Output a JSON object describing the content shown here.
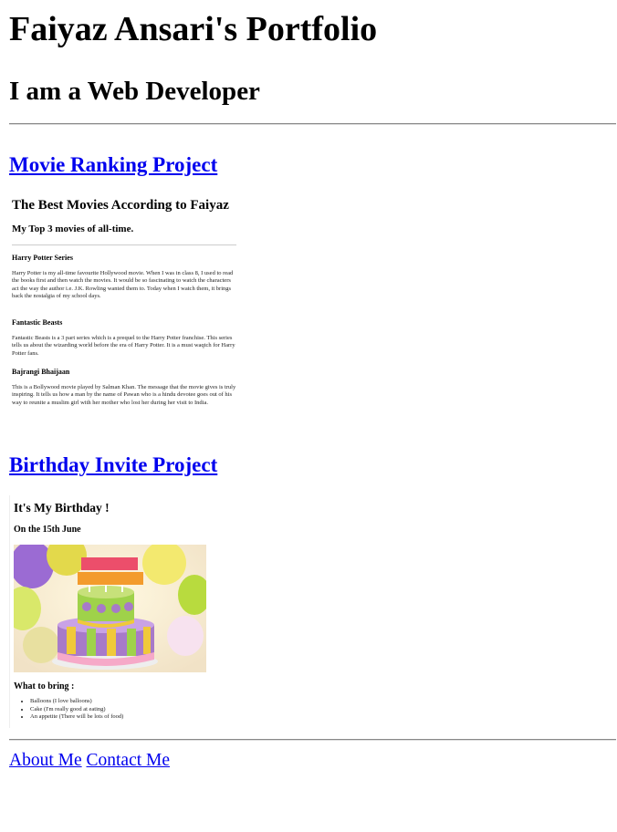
{
  "header": {
    "title": "Faiyaz Ansari's Portfolio",
    "subtitle": "I am a Web Developer"
  },
  "projects": [
    {
      "link_label": "Movie Ranking Project",
      "preview": {
        "title": "The Best Movies According to Faiyaz",
        "subtitle": "My Top 3 movies of all-time.",
        "movies": [
          {
            "name": "Harry Potter Series",
            "text": "Harry Potter is my all-time favourite Hollywood movie. When I was in class 8, I used to read the books first and then watch the movies. It would be so fascinating to watch the characters act the way the author i.e. J.K. Rowling wanted them to. Today when I watch them, it brings back the nostalgia of my school days."
          },
          {
            "name": "Fantastic Beasts",
            "text": "Fantastic Beasts is a 3 part series which is a prequel to the Harry Potter franchise. This series tells us about the wizarding world before the era of Harry Potter. It is a must waqtch for Harry Potter fans."
          },
          {
            "name": "Bajrangi Bhaijaan",
            "text": "This is a Bollywood movie played by Salman Khan. The message that the movie gives is truly inspiring. It tells us how a man by the name of Pawan who is a hindu devotee goes out of his way to reunite a muslim girl with her mother who lost her during her visit to India."
          }
        ]
      }
    },
    {
      "link_label": "Birthday Invite Project",
      "preview": {
        "title": "It's My Birthday !",
        "subtitle": "On the 15th June",
        "bring_heading": "What to bring :",
        "items": [
          "Balloons (I love balloons)",
          "Cake (I'm really good at eating)",
          "An appetite (There will be lots of food)"
        ]
      }
    }
  ],
  "footer": {
    "about_label": "About Me",
    "contact_label": "Contact Me"
  },
  "colors": {
    "link": "#0000ee",
    "rule": "#888888"
  }
}
